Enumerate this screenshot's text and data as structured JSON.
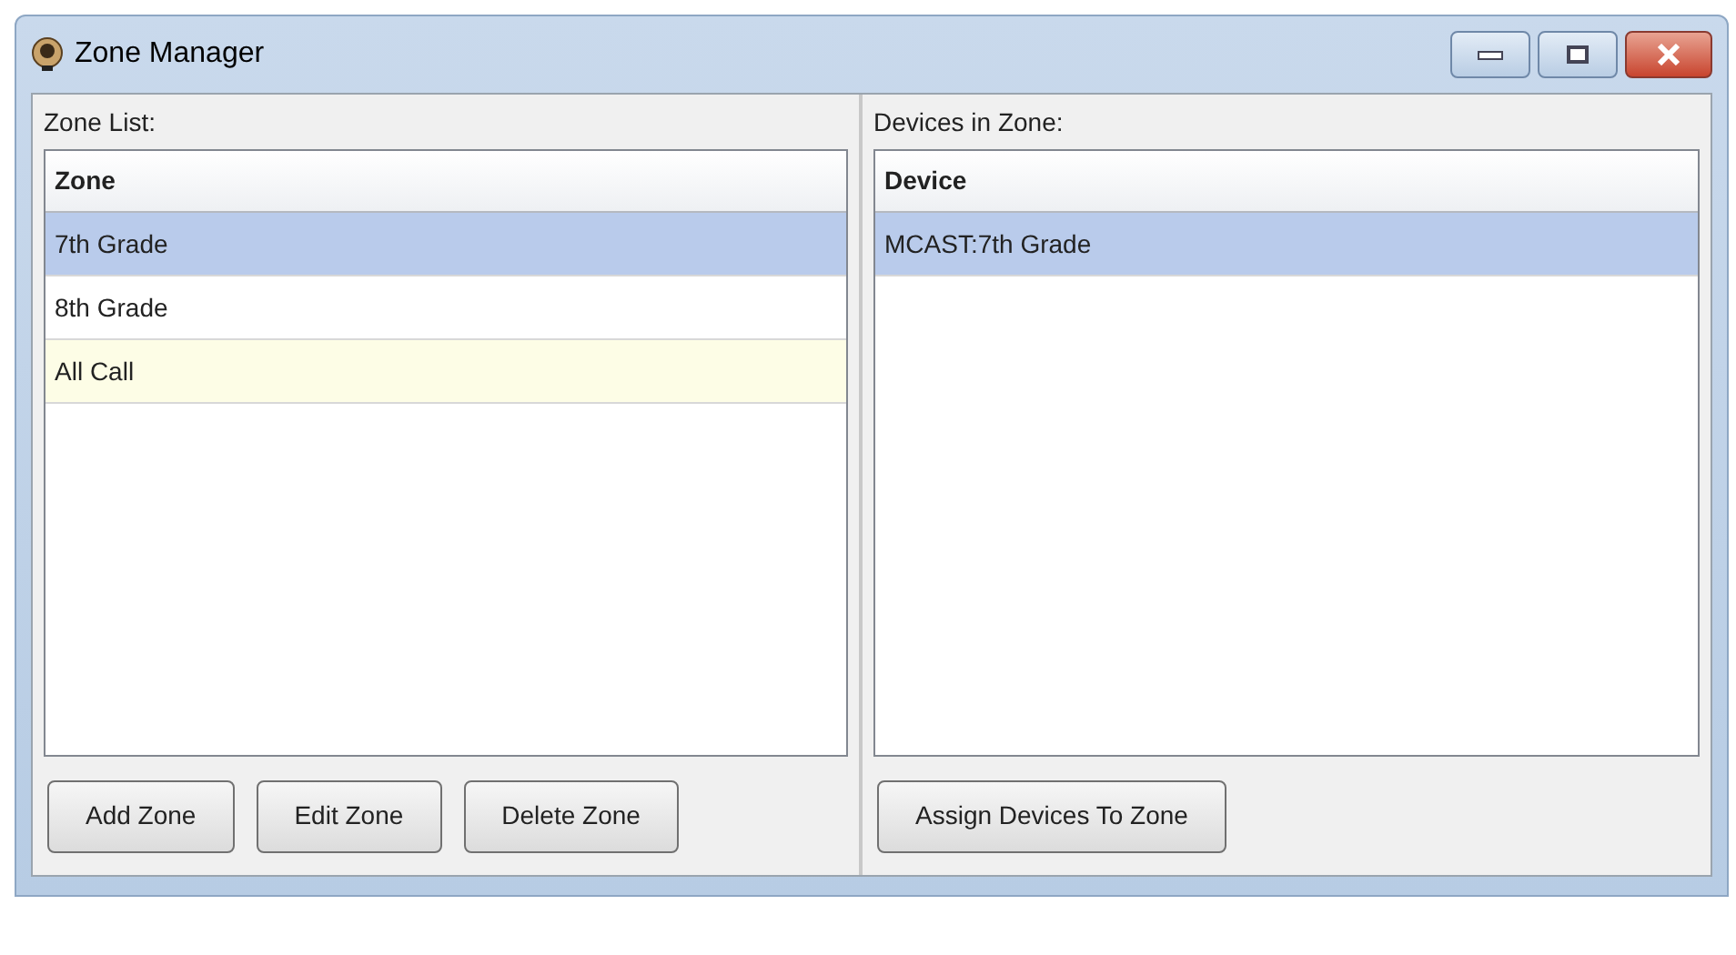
{
  "window": {
    "title": "Zone Manager"
  },
  "zone_panel": {
    "label": "Zone List:",
    "column": "Zone",
    "rows": [
      {
        "text": "7th Grade",
        "selected": true
      },
      {
        "text": "8th Grade",
        "selected": false,
        "hovered": false
      },
      {
        "text": "All Call",
        "selected": false,
        "hovered": true
      }
    ],
    "buttons": [
      "Add Zone",
      "Edit Zone",
      "Delete Zone"
    ]
  },
  "device_panel": {
    "label": "Devices in Zone:",
    "column": "Device",
    "rows": [
      {
        "text": "MCAST:7th Grade",
        "selected": true
      }
    ],
    "buttons": [
      "Assign Devices To Zone"
    ]
  }
}
